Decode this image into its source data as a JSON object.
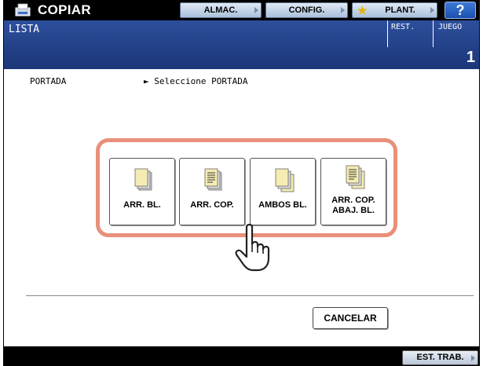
{
  "app": {
    "title": "COPIAR",
    "icon": "copier-icon"
  },
  "toolbar": {
    "store_label": "ALMAC.",
    "settings_label": "CONFIG.",
    "template_label": "PLANT.",
    "help_label": "?"
  },
  "header": {
    "title": "LISTA",
    "remaining_label": "REST.",
    "set_label": "JUEGO",
    "set_count": "1"
  },
  "status": {
    "label": "PORTADA",
    "message": "► Seleccione PORTADA"
  },
  "options": [
    {
      "label": "ARR. BL.",
      "icon": "blank-top-cover-icon"
    },
    {
      "label": "ARR. COP.",
      "icon": "copied-top-cover-icon"
    },
    {
      "label": "AMBOS BL.",
      "icon": "both-blank-covers-icon"
    },
    {
      "label": "ARR. COP.\nABAJ. BL.",
      "icon": "copied-top-blank-bottom-icon"
    }
  ],
  "cancel_label": "CANCELAR",
  "bottom": {
    "job_status_label": "EST. TRAB."
  },
  "colors": {
    "header_blue": "#1c3678",
    "highlight": "#e98f7a",
    "page_yellow": "#f4ecb2",
    "page_gray": "#dcdcdc"
  }
}
